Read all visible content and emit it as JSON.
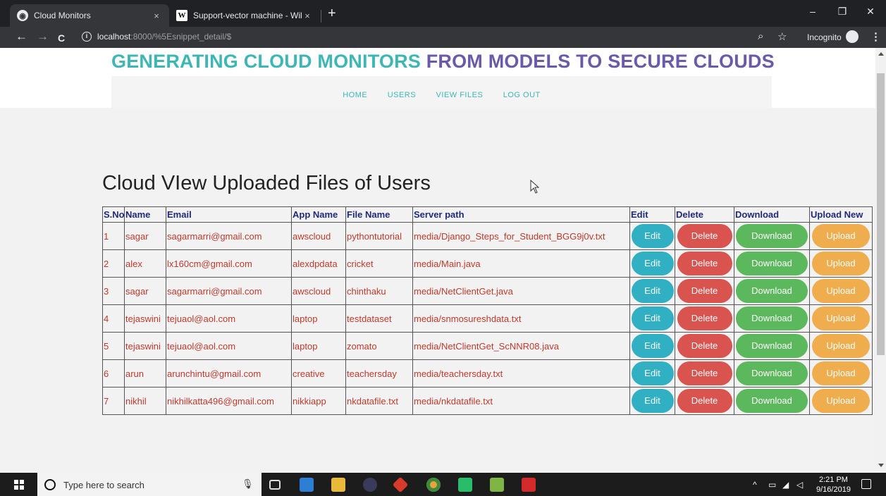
{
  "browser": {
    "tabs": [
      {
        "title": "Cloud Monitors",
        "close": "×"
      },
      {
        "title": "Support-vector machine - Wikipe",
        "close": "×"
      }
    ],
    "new_tab": "+",
    "window_controls": {
      "minimize": "–",
      "restore": "❐",
      "close": "✕"
    },
    "nav": {
      "back": "←",
      "forward": "→",
      "reload": "C"
    },
    "url_host": "localhost",
    "url_path": ":8000/%5Esnippet_detail/$",
    "incognito_label": "Incognito"
  },
  "site": {
    "title_part1": "GENERATING CLOUD MONITORS",
    "title_part2": "FROM MODELS TO SECURE CLOUDS",
    "nav": [
      "HOME",
      "USERS",
      "VIEW FILES",
      "LOG OUT"
    ],
    "colors": {
      "teal": "#3db7b5",
      "purple": "#6a5aaa"
    }
  },
  "main": {
    "heading": "Cloud VIew Uploaded Files of Users",
    "table": {
      "columns": [
        "S.No",
        "Name",
        "Email",
        "App Name",
        "File Name",
        "Server path",
        "Edit",
        "Delete",
        "Download",
        "Upload New"
      ],
      "buttons": {
        "edit": "Edit",
        "delete": "Delete",
        "download": "Download",
        "upload": "Upload"
      },
      "rows": [
        {
          "sno": "1",
          "name": "sagar",
          "email": "sagarmarri@gmail.com",
          "app": "awscloud",
          "file": "pythontutorial",
          "path": "media/Django_Steps_for_Student_BGG9j0v.txt"
        },
        {
          "sno": "2",
          "name": "alex",
          "email": "lx160cm@gmail.com",
          "app": "alexdpdata",
          "file": "cricket",
          "path": "media/Main.java"
        },
        {
          "sno": "3",
          "name": "sagar",
          "email": "sagarmarri@gmail.com",
          "app": "awscloud",
          "file": "chinthaku",
          "path": "media/NetClientGet.java"
        },
        {
          "sno": "4",
          "name": "tejaswini",
          "email": "tejuaol@aol.com",
          "app": "laptop",
          "file": "testdataset",
          "path": "media/snmosureshdata.txt"
        },
        {
          "sno": "5",
          "name": "tejaswini",
          "email": "tejuaol@aol.com",
          "app": "laptop",
          "file": "zomato",
          "path": "media/NetClientGet_ScNNR08.java"
        },
        {
          "sno": "6",
          "name": "arun",
          "email": "arunchintu@gmail.com",
          "app": "creative",
          "file": "teachersday",
          "path": "media/teachersday.txt"
        },
        {
          "sno": "7",
          "name": "nikhil",
          "email": "nikhilkatta496@gmail.com",
          "app": "nikkiapp",
          "file": "nkdatafile.txt",
          "path": "media/nkdatafile.txt"
        }
      ]
    }
  },
  "taskbar": {
    "search_placeholder": "Type here to search",
    "time": "2:21 PM",
    "date": "9/16/2019",
    "tray_up": "^"
  }
}
